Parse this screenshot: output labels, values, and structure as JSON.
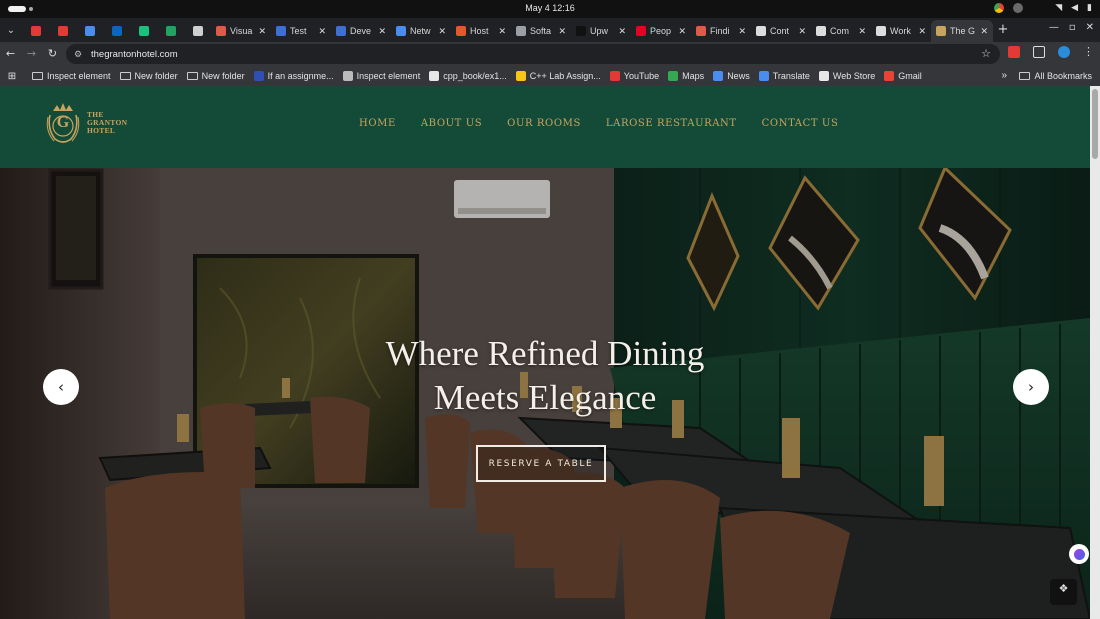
{
  "os": {
    "clock": "May 4  12:16"
  },
  "tabs": [
    {
      "label": "",
      "icon": "youtube-icon",
      "color": "#e53935",
      "kind": "pin"
    },
    {
      "label": "",
      "icon": "youtube-icon",
      "color": "#e53935",
      "kind": "pin"
    },
    {
      "label": "",
      "icon": "gemini-icon",
      "color": "#4a8cf0",
      "kind": "pin"
    },
    {
      "label": "",
      "icon": "linkedin-icon",
      "color": "#0a66c2",
      "kind": "pin"
    },
    {
      "label": "",
      "icon": "chatgpt-icon",
      "color": "#19c37d",
      "kind": "pin"
    },
    {
      "label": "",
      "icon": "sheets-icon",
      "color": "#1fa463",
      "kind": "pin"
    },
    {
      "label": "",
      "icon": "folder-icon",
      "color": "#cfcfcf",
      "kind": "pin"
    },
    {
      "label": "Visua",
      "icon": "figma-icon",
      "color": "#e4584a",
      "kind": "std"
    },
    {
      "label": "Test",
      "icon": "c-icon",
      "color": "#3d6fd6",
      "kind": "std"
    },
    {
      "label": "Deve",
      "icon": "c-icon",
      "color": "#3d6fd6",
      "kind": "std"
    },
    {
      "label": "Netw",
      "icon": "gemini-icon",
      "color": "#4a8cf0",
      "kind": "std"
    },
    {
      "label": "Host",
      "icon": "hostinger-icon",
      "color": "#e8572b",
      "kind": "std"
    },
    {
      "label": "Softa",
      "icon": "image-icon",
      "color": "#9aa0a6",
      "kind": "std"
    },
    {
      "label": "Upw",
      "icon": "upwork-icon",
      "color": "#111111",
      "kind": "std"
    },
    {
      "label": "Peop",
      "icon": "pinterest-icon",
      "color": "#e60023",
      "kind": "std"
    },
    {
      "label": "Findi",
      "icon": "figma-icon",
      "color": "#e4584a",
      "kind": "std"
    },
    {
      "label": "Cont",
      "icon": "github-icon",
      "color": "#dddddd",
      "kind": "std"
    },
    {
      "label": "Com",
      "icon": "github-icon",
      "color": "#dddddd",
      "kind": "std"
    },
    {
      "label": "Work",
      "icon": "github-icon",
      "color": "#dddddd",
      "kind": "std"
    },
    {
      "label": "The G",
      "icon": "hotel-icon",
      "color": "#c9a45e",
      "kind": "active"
    }
  ],
  "address": {
    "url": "thegrantonhotel.com"
  },
  "bookmarks": [
    {
      "label": "Inspect element",
      "icon": "folder-icon",
      "kind": "folder",
      "color": "#cccccc"
    },
    {
      "label": "New folder",
      "icon": "folder-icon",
      "kind": "folder",
      "color": "#cccccc"
    },
    {
      "label": "New folder",
      "icon": "folder-icon",
      "kind": "folder",
      "color": "#cccccc"
    },
    {
      "label": "If an assignme...",
      "icon": "star-icon",
      "kind": "link",
      "color": "#2f4fb5"
    },
    {
      "label": "Inspect element",
      "icon": "globe-icon",
      "kind": "link",
      "color": "#bbbbbb"
    },
    {
      "label": "cpp_book/ex1...",
      "icon": "github-icon",
      "kind": "link",
      "color": "#e8e8e8"
    },
    {
      "label": "C++ Lab Assign...",
      "icon": "smile-icon",
      "kind": "link",
      "color": "#f5c518"
    },
    {
      "label": "YouTube",
      "icon": "youtube-icon",
      "kind": "link",
      "color": "#e53935"
    },
    {
      "label": "Maps",
      "icon": "maps-icon",
      "kind": "link",
      "color": "#34a853"
    },
    {
      "label": "News",
      "icon": "news-icon",
      "kind": "link",
      "color": "#4a8cf0"
    },
    {
      "label": "Translate",
      "icon": "translate-icon",
      "kind": "link",
      "color": "#4a8cf0"
    },
    {
      "label": "Web Store",
      "icon": "webstore-icon",
      "kind": "link",
      "color": "#e8e8e8"
    },
    {
      "label": "Gmail",
      "icon": "gmail-icon",
      "kind": "link",
      "color": "#ea4335"
    }
  ],
  "bookmarks_all": "All Bookmarks",
  "site": {
    "logo_line1": "THE",
    "logo_line2": "GRANTON",
    "logo_line3": "HOTEL",
    "logo_letter": "G",
    "nav": [
      "HOME",
      "ABOUT US",
      "OUR ROOMS",
      "LAROSE RESTAURANT",
      "CONTACT US"
    ],
    "hero_title_line1": "Where Refined Dining",
    "hero_title_line2": "Meets Elegance",
    "cta": "RESERVE A TABLE",
    "prev_arrow": "‹",
    "next_arrow": "›",
    "colors": {
      "header": "#134b38",
      "gold": "#c9a45e"
    }
  }
}
